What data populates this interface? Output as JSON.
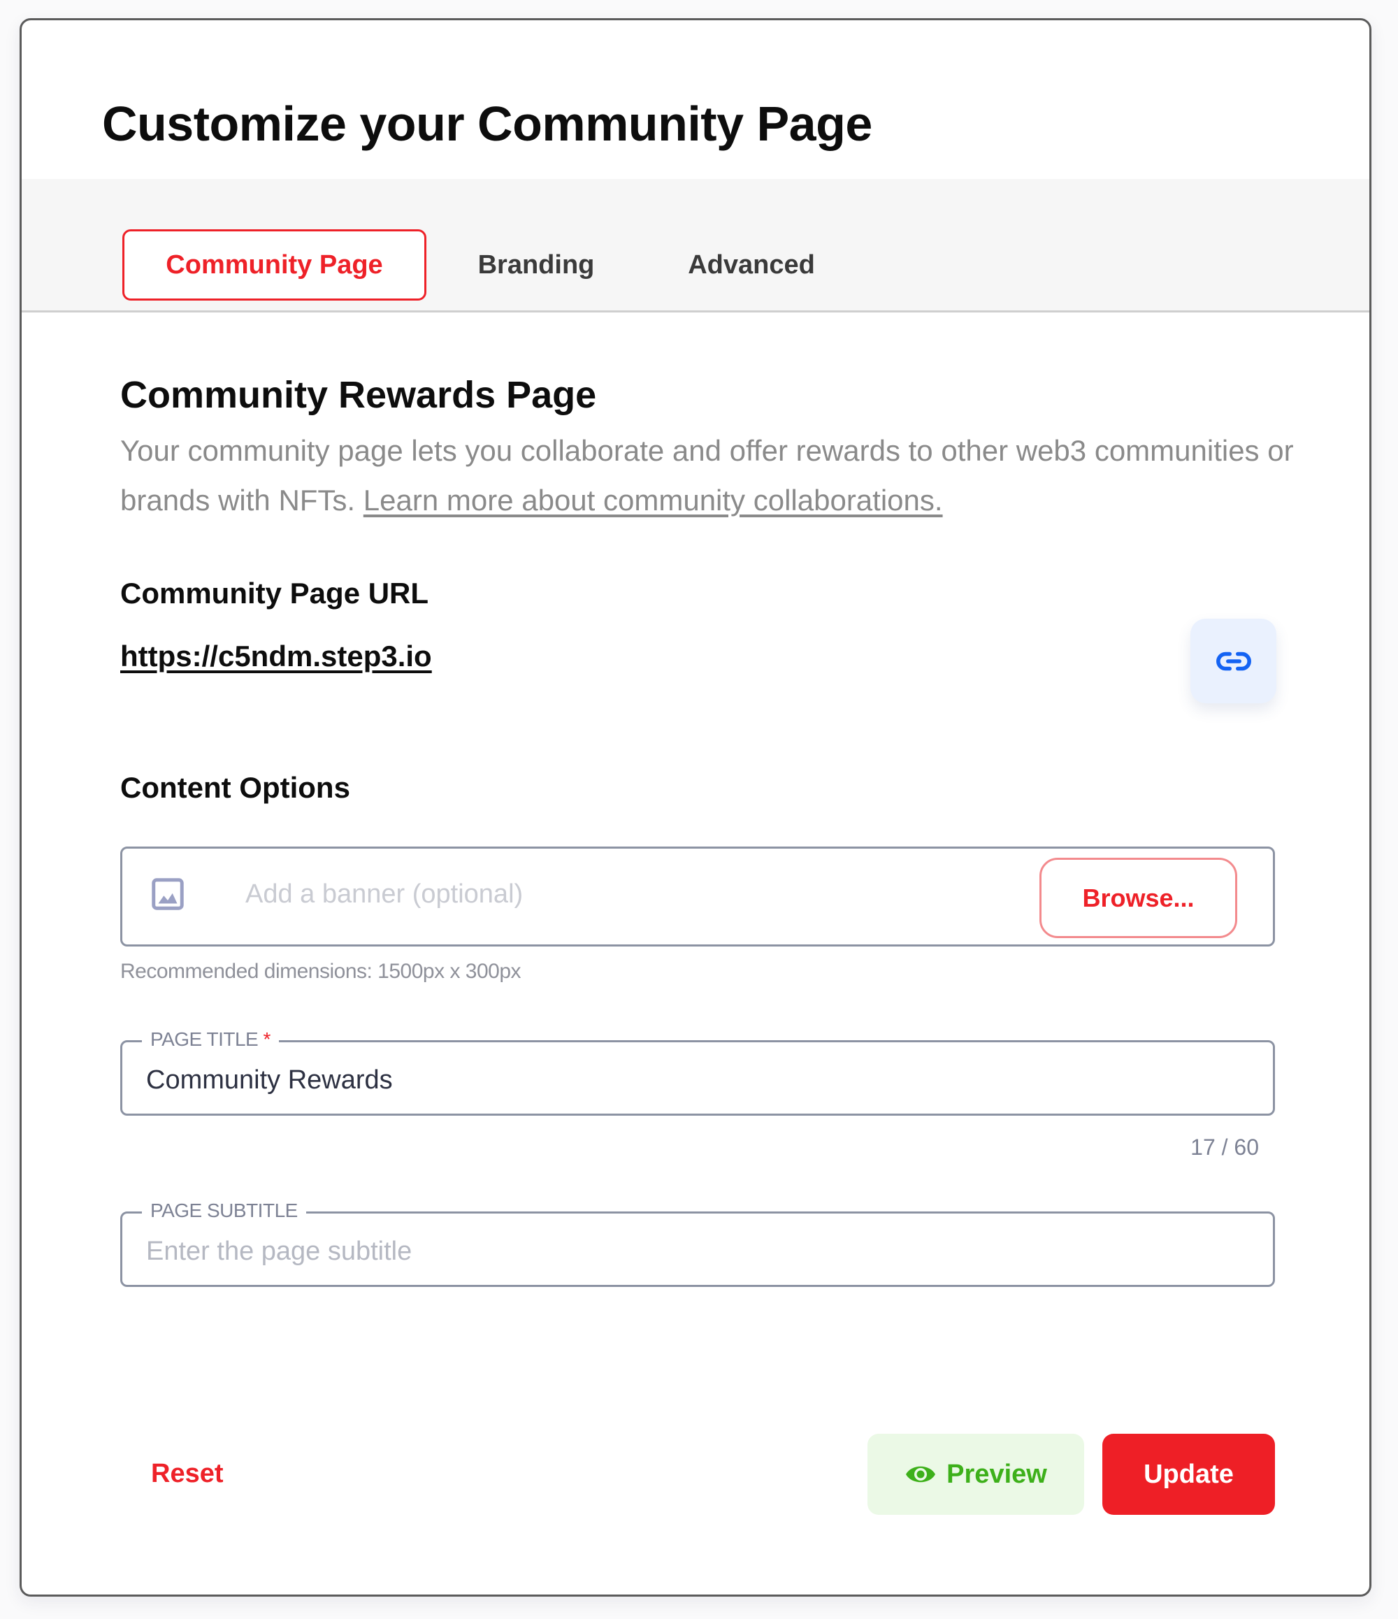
{
  "header": {
    "title": "Customize your Community Page"
  },
  "tabs": [
    {
      "label": "Community Page",
      "active": true
    },
    {
      "label": "Branding",
      "active": false
    },
    {
      "label": "Advanced",
      "active": false
    }
  ],
  "section": {
    "title": "Community Rewards Page",
    "description": "Your community page lets you collaborate and offer rewards to other web3 communities or brands with NFTs.",
    "learn_more_link": "Learn more about community collaborations."
  },
  "url_block": {
    "label": "Community Page URL",
    "url": "https://c5ndm.step3.io",
    "copy_icon": "link-icon"
  },
  "content_options": {
    "label": "Content Options",
    "banner": {
      "icon": "image-icon",
      "placeholder": "Add a banner (optional)",
      "browse_label": "Browse...",
      "hint": "Recommended dimensions: 1500px x 300px"
    },
    "page_title": {
      "label": "PAGE TITLE",
      "required_mark": "*",
      "value": "Community Rewards",
      "counter": "17 / 60"
    },
    "page_subtitle": {
      "label": "PAGE SUBTITLE",
      "value": "",
      "placeholder": "Enter the page subtitle"
    }
  },
  "footer": {
    "reset_label": "Reset",
    "preview_label": "Preview",
    "preview_icon": "eye-icon",
    "update_label": "Update"
  },
  "colors": {
    "accent": "#ee2128",
    "link_button_bg": "#eaf1fe",
    "link_icon": "#1463f3",
    "preview_bg": "#ebf9e6",
    "preview_fg": "#3db01a"
  }
}
